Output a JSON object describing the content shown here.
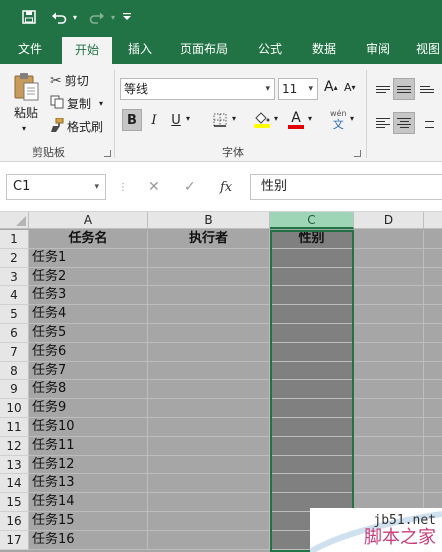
{
  "quick_access": {
    "save_icon": "save-icon",
    "undo_icon": "undo-icon",
    "redo_icon": "redo-icon",
    "customize_icon": "customize-qat-icon"
  },
  "tabs": [
    "文件",
    "开始",
    "插入",
    "页面布局",
    "公式",
    "数据",
    "审阅",
    "视图"
  ],
  "active_tab": "开始",
  "ribbon": {
    "clipboard": {
      "paste_label": "粘贴",
      "cut_label": "剪切",
      "copy_label": "复制",
      "format_painter_label": "格式刷",
      "group_label": "剪贴板"
    },
    "font": {
      "font_name": "等线",
      "font_size": "11",
      "bold": "B",
      "italic": "I",
      "underline": "U",
      "font_color_glyph": "A",
      "phonetic_glyph_top": "wén",
      "phonetic_glyph_bottom": "文",
      "group_label": "字体"
    }
  },
  "formula_bar": {
    "name_box": "C1",
    "fx_label": "fx",
    "cancel_glyph": "✕",
    "enter_glyph": "✓",
    "formula": "性别"
  },
  "sheet": {
    "columns": [
      "A",
      "B",
      "C",
      "D"
    ],
    "selected_column": "C",
    "row_numbers": [
      "1",
      "2",
      "3",
      "4",
      "5",
      "6",
      "7",
      "8",
      "9",
      "10",
      "11",
      "12",
      "13",
      "14",
      "15",
      "16",
      "17"
    ],
    "header_row": [
      "任务名",
      "执行者",
      "性别"
    ],
    "task_names": [
      "任务1",
      "任务2",
      "任务3",
      "任务4",
      "任务5",
      "任务6",
      "任务7",
      "任务8",
      "任务9",
      "任务10",
      "任务11",
      "任务12",
      "任务13",
      "任务14",
      "任务15",
      "任务16"
    ]
  },
  "watermark": {
    "site": "jb51.net",
    "text": "脚本之家"
  },
  "colors": {
    "accent": "#217346",
    "header_fill": "#ffc000",
    "grid_fill": "#a6a6a6",
    "selected_column_fill": "#808080"
  }
}
